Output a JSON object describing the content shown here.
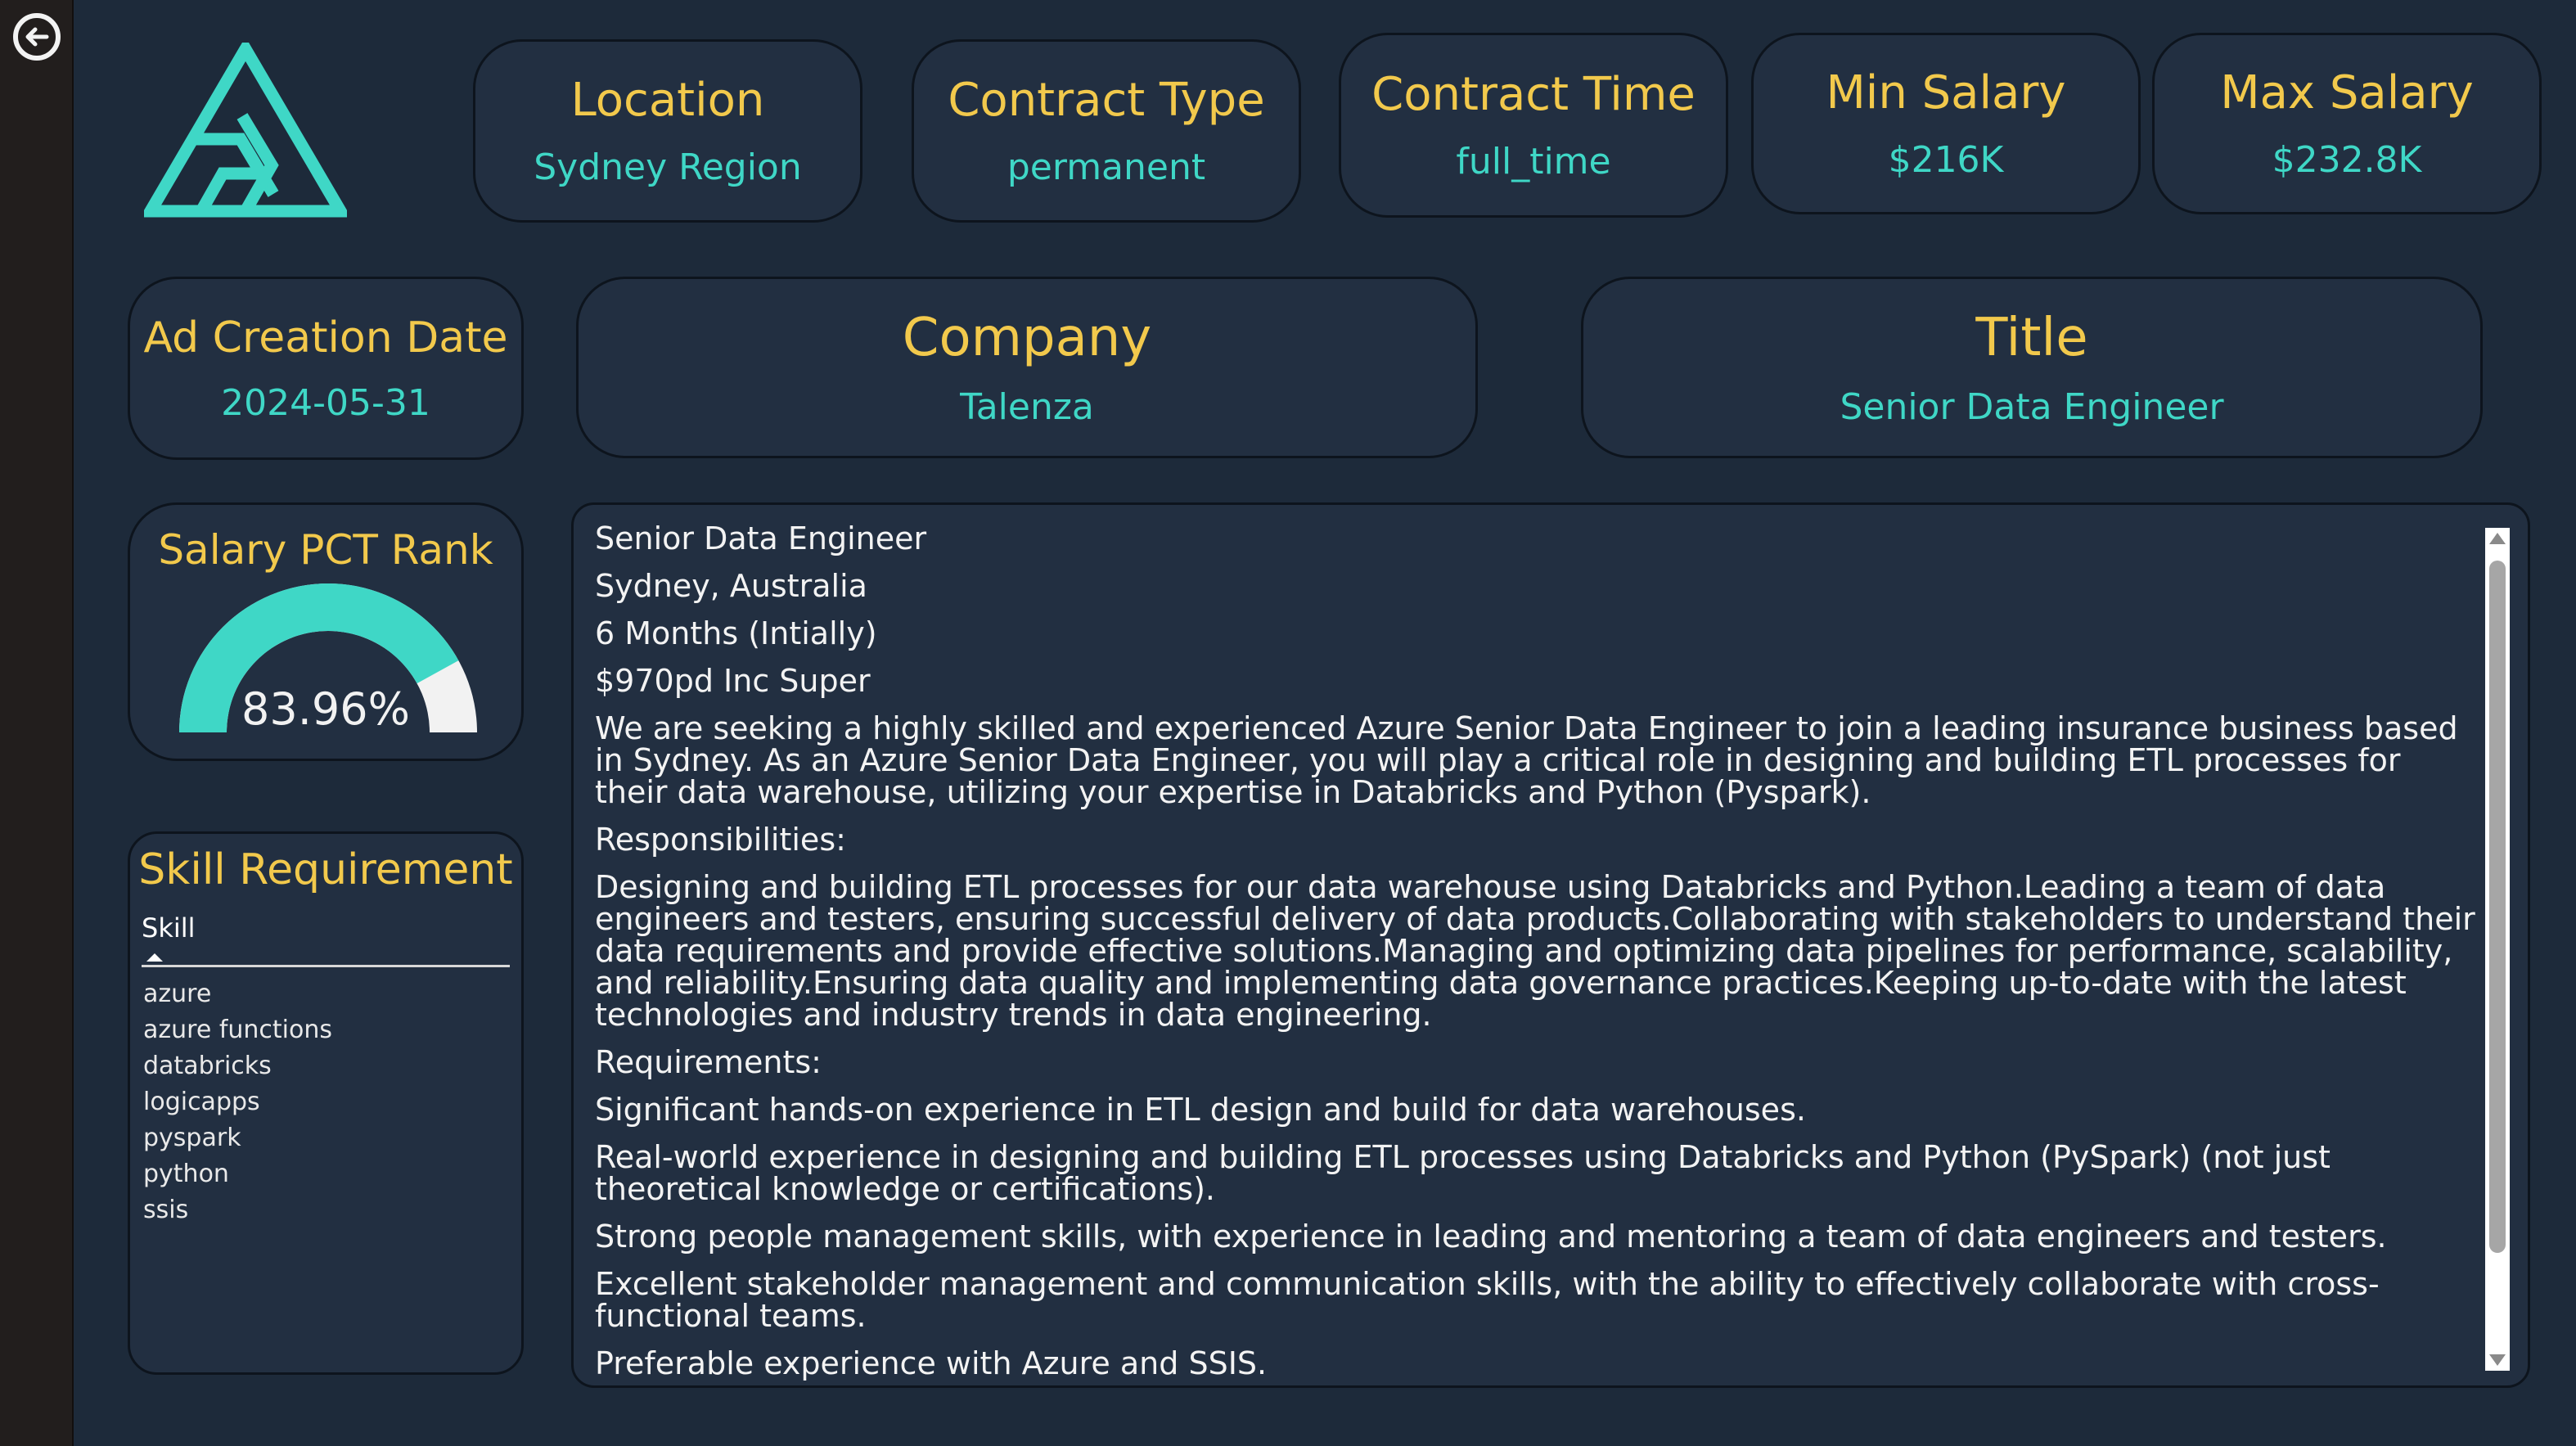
{
  "nav": {
    "back_icon": "back-arrow-icon"
  },
  "colors": {
    "label": "#f2c94c",
    "value": "#3fd7c6",
    "card_bg": "#222f41",
    "page_bg": "#1d2a3a",
    "gauge_fill": "#3fd7c6",
    "gauge_track": "#f2f2f2"
  },
  "kpis": {
    "location": {
      "label": "Location",
      "value": "Sydney Region"
    },
    "contract_type": {
      "label": "Contract Type",
      "value": "permanent"
    },
    "contract_time": {
      "label": "Contract Time",
      "value": "full_time"
    },
    "min_salary": {
      "label": "Min Salary",
      "value": "$216K"
    },
    "max_salary": {
      "label": "Max Salary",
      "value": "$232.8K"
    },
    "ad_creation_date": {
      "label": "Ad Creation Date",
      "value": "2024-05-31"
    },
    "company": {
      "label": "Company",
      "value": "Talenza"
    },
    "title": {
      "label": "Title",
      "value": "Senior Data Engineer"
    }
  },
  "salary_rank": {
    "title": "Salary PCT Rank",
    "value": 0.8396,
    "display": "83.96%"
  },
  "skills": {
    "title": "Skill Requirement",
    "column_header": "Skill",
    "items": [
      "azure",
      "azure functions",
      "databricks",
      "logicapps",
      "pyspark",
      "python",
      "ssis"
    ]
  },
  "description": {
    "paragraphs": [
      "Senior Data Engineer",
      "Sydney, Australia",
      "6 Months (Intially)",
      "$970pd Inc Super",
      "We are seeking a highly skilled and experienced Azure Senior Data Engineer to join a leading insurance business based in Sydney. As an Azure Senior Data Engineer, you will play a critical role in designing and building ETL processes for their data warehouse, utilizing your expertise in Databricks and Python (Pyspark).",
      "Responsibilities:",
      "Designing and building ETL processes for our data warehouse using Databricks and Python.Leading a team of data engineers and testers, ensuring successful delivery of data products.Collaborating with stakeholders to understand their data requirements and provide effective solutions.Managing and optimizing data pipelines for performance, scalability, and reliability.Ensuring data quality and implementing data governance practices.Keeping up-to-date with the latest technologies and industry trends in data engineering.",
      "Requirements:",
      "Significant hands-on experience in ETL design and build for data warehouses.",
      "Real-world experience in designing and building ETL processes using Databricks and Python (PySpark) (not just theoretical knowledge or certifications).",
      "Strong people management skills, with experience in leading and mentoring a team of data engineers and testers.",
      "Excellent stakeholder management and communication skills, with the ability to effectively collaborate with cross-functional teams.",
      "Preferable experience with Azure and SSIS."
    ]
  }
}
